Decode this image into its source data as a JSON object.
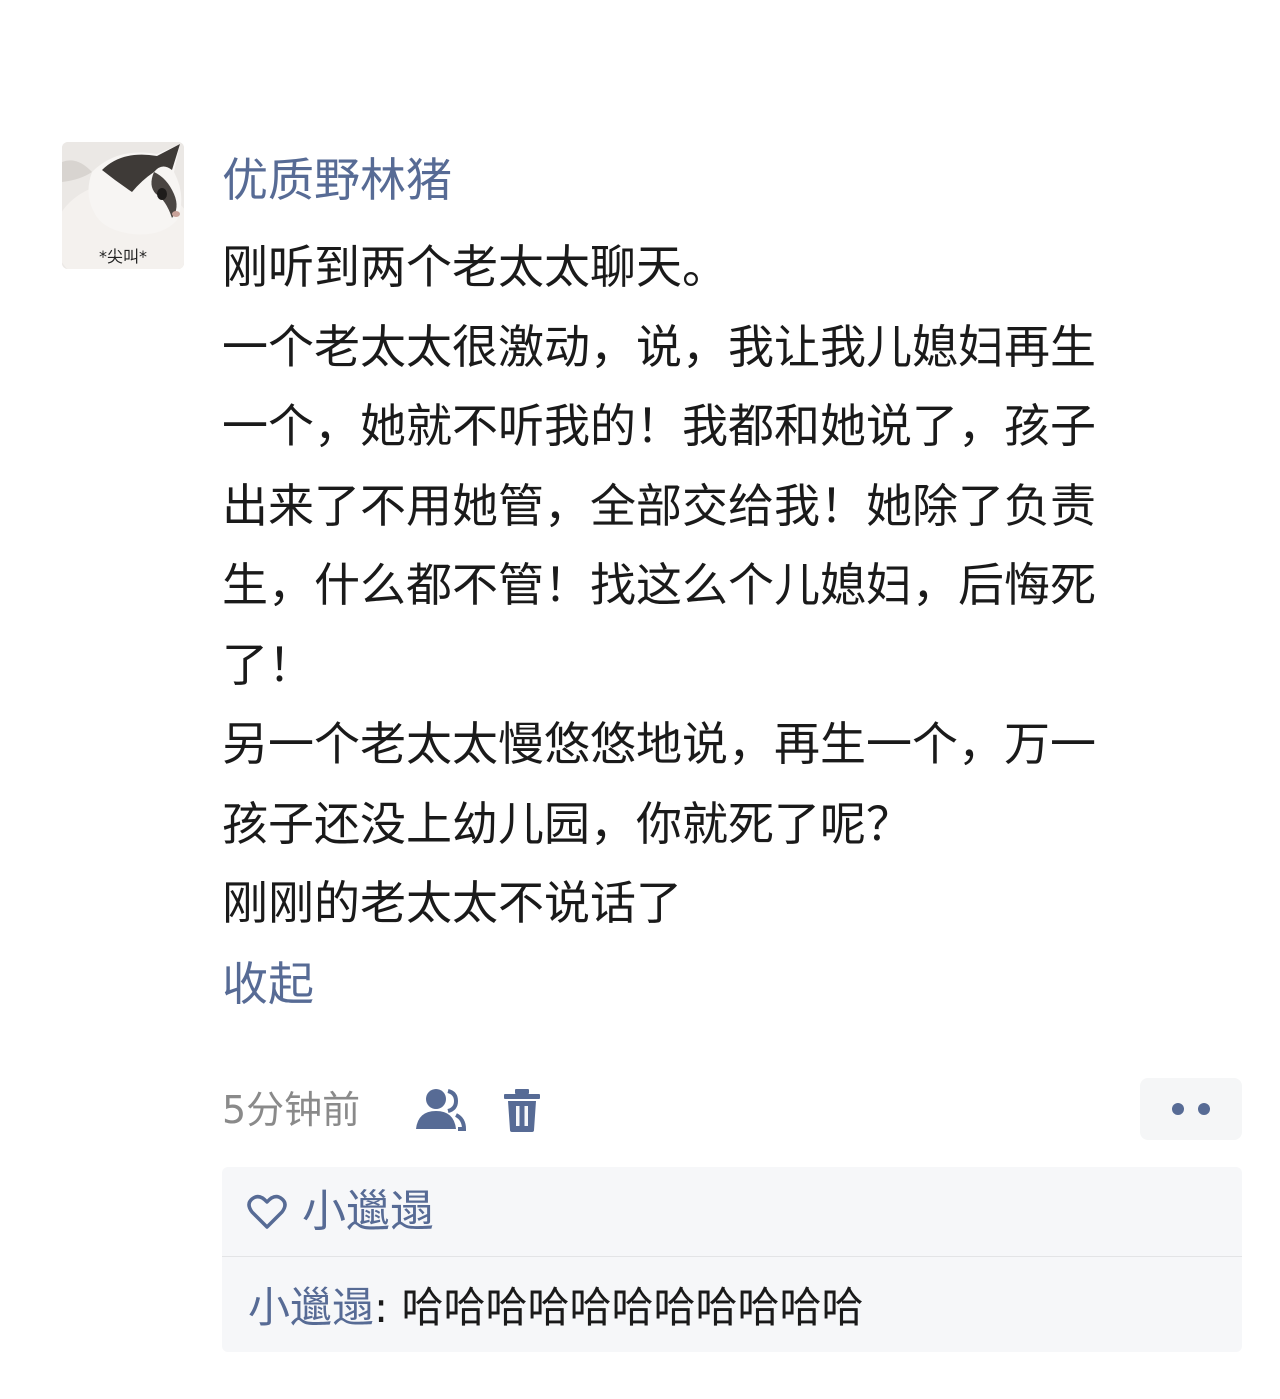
{
  "post": {
    "avatar": {
      "caption": "*尖叫*"
    },
    "username": "优质野林猪",
    "content_lines": [
      "刚听到两个老太太聊天。",
      "一个老太太很激动，说，我让我儿媳妇再生",
      "一个，她就不听我的！我都和她说了，孩子",
      "出来了不用她管，全部交给我！她除了负责",
      "生，什么都不管！找这么个儿媳妇，后悔死",
      "了！",
      "另一个老太太慢悠悠地说，再生一个，万一",
      "孩子还没上幼儿园，你就死了呢？",
      "刚刚的老太太不说话了"
    ],
    "collapse_label": "收起",
    "time": "5分钟前",
    "icons": {
      "privacy": "people-icon",
      "delete": "trash-icon",
      "more": "more-dots-icon",
      "like": "heart-icon"
    }
  },
  "interactions": {
    "likes": [
      "小邋遢"
    ],
    "comments": [
      {
        "author": "小邋遢",
        "separator": ": ",
        "text": "哈哈哈哈哈哈哈哈哈哈哈"
      }
    ]
  },
  "colors": {
    "link": "#576b95",
    "text": "#1a1a1a",
    "meta": "#8a8a8a",
    "interaction_bg": "#f6f7f9"
  }
}
